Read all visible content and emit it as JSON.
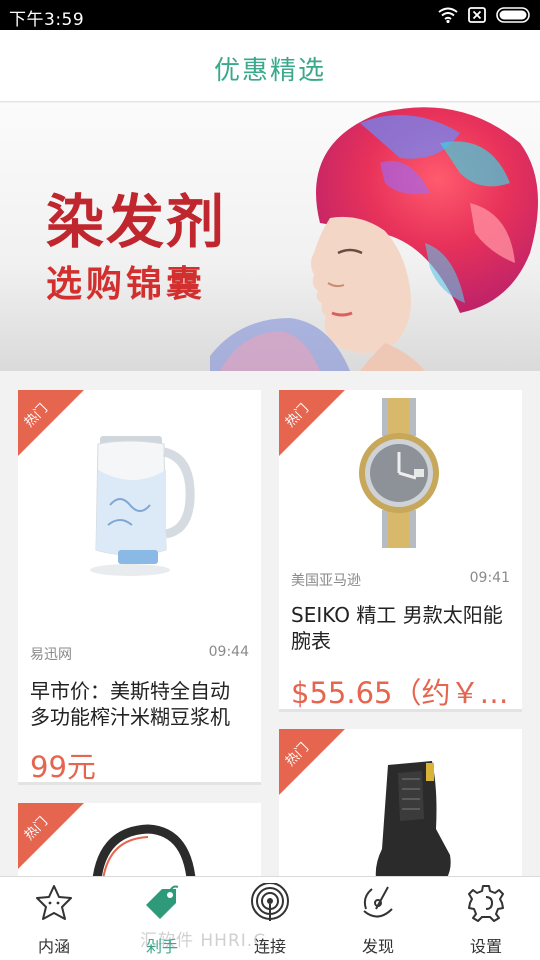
{
  "status_bar": {
    "time": "下午3:59",
    "icons": [
      "wifi-icon",
      "sim-icon",
      "battery-icon"
    ]
  },
  "header": {
    "title": "优惠精选"
  },
  "banner": {
    "line1": "染发剂",
    "line2": "选购锦囊"
  },
  "badge_text": "热门",
  "products": [
    {
      "source": "易迅网",
      "time": "09:44",
      "title": "早市价：美斯特全自动多功能榨汁米糊豆浆机",
      "price": "99元"
    },
    {
      "source": "美国亚马逊",
      "time": "09:41",
      "title": "SEIKO 精工 男款太阳能腕表",
      "price": "$55.65（约￥4..."
    }
  ],
  "tabs": [
    {
      "label": "内涵",
      "icon": "star-face-icon"
    },
    {
      "label": "剁手",
      "icon": "price-tag-icon",
      "active": true
    },
    {
      "label": "连接",
      "icon": "signal-icon"
    },
    {
      "label": "发现",
      "icon": "compass-icon"
    },
    {
      "label": "设置",
      "icon": "gear-icon"
    }
  ],
  "watermark": "汇软件 HHRI.C",
  "colors": {
    "accent": "#3aa88a",
    "badge": "#e5654f",
    "price": "#e5654f"
  }
}
